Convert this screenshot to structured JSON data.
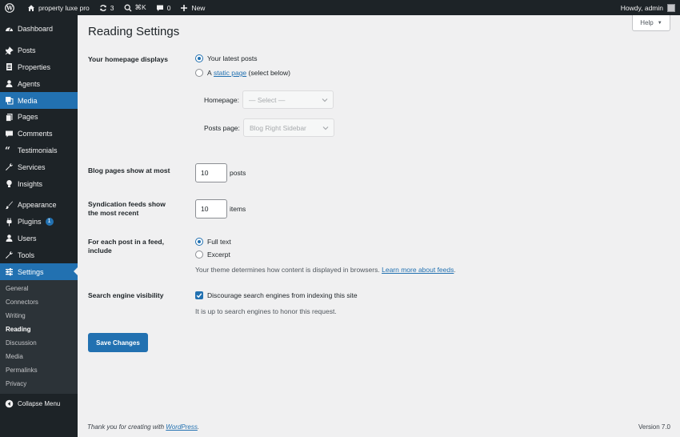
{
  "adminbar": {
    "site_name": "property luxe pro",
    "updates_count": "3",
    "search_shortcut": "⌘K",
    "comments_count": "0",
    "new_label": "New",
    "howdy": "Howdy, admin"
  },
  "sidebar": {
    "items": [
      {
        "label": "Dashboard"
      },
      {
        "label": "Posts"
      },
      {
        "label": "Properties"
      },
      {
        "label": "Agents"
      },
      {
        "label": "Media"
      },
      {
        "label": "Pages"
      },
      {
        "label": "Comments"
      },
      {
        "label": "Testimonials"
      },
      {
        "label": "Services"
      },
      {
        "label": "Insights"
      },
      {
        "label": "Appearance"
      },
      {
        "label": "Plugins",
        "badge": "1"
      },
      {
        "label": "Users"
      },
      {
        "label": "Tools"
      },
      {
        "label": "Settings"
      }
    ],
    "submenu": [
      "General",
      "Connectors",
      "Writing",
      "Reading",
      "Discussion",
      "Media",
      "Permalinks",
      "Privacy"
    ],
    "collapse_label": "Collapse Menu"
  },
  "help_label": "Help",
  "page_title": "Reading Settings",
  "homepage": {
    "label": "Your homepage displays",
    "option_latest": "Your latest posts",
    "option_static_prefix": "A",
    "option_static_link": "static page",
    "option_static_suffix": "(select below)",
    "homepage_label": "Homepage:",
    "homepage_value": "— Select —",
    "posts_page_label": "Posts page:",
    "posts_page_value": "Blog Right Sidebar"
  },
  "blog_pages": {
    "label": "Blog pages show at most",
    "value": "10",
    "unit": "posts"
  },
  "syndication": {
    "label": "Syndication feeds show the most recent",
    "value": "10",
    "unit": "items"
  },
  "feed_content": {
    "label": "For each post in a feed, include",
    "option_full": "Full text",
    "option_excerpt": "Excerpt",
    "description_prefix": "Your theme determines how content is displayed in browsers.",
    "description_link": "Learn more about feeds",
    "description_suffix": "."
  },
  "search_visibility": {
    "label": "Search engine visibility",
    "checkbox_label": "Discourage search engines from indexing this site",
    "checked": true,
    "description": "It is up to search engines to honor this request."
  },
  "save_label": "Save Changes",
  "footer": {
    "thanks_prefix": "Thank you for creating with",
    "thanks_link": "WordPress",
    "thanks_suffix": ".",
    "version": "Version 7.0"
  },
  "colors": {
    "accent": "#2271b1",
    "adminbar_bg": "#1d2327"
  }
}
